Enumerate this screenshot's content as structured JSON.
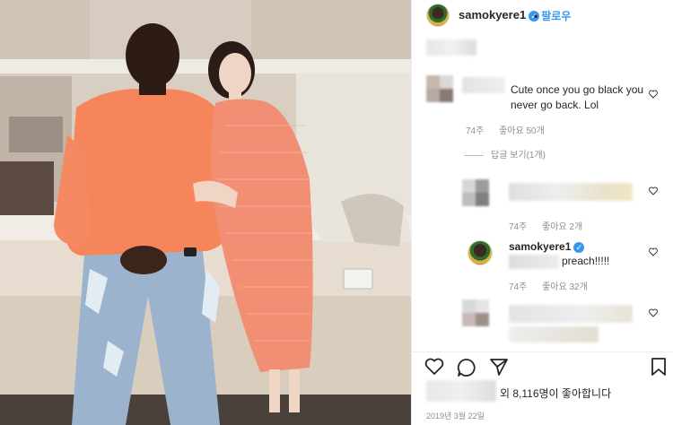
{
  "header": {
    "username": "samokyere1",
    "verified_mark": "✓",
    "follow_label": "팔로우"
  },
  "comments": [
    {
      "text": "Cute once you go black you never go back. Lol",
      "age": "74주",
      "likes": "좋아요 50개"
    },
    {
      "replies_label": "답글 보기(1개)"
    },
    {
      "age": "74주",
      "likes": "좋아요 2개"
    },
    {
      "username": "samokyere1",
      "text": "preach!!!!!",
      "age": "74주",
      "likes": "좋아요 32개"
    }
  ],
  "actions": {
    "icons": [
      "heart-icon",
      "comment-icon",
      "share-icon",
      "bookmark-icon"
    ]
  },
  "likes_line": "외 8,116명이 좋아합니다",
  "date": "2019년 3월 22일",
  "colors": {
    "link_blue": "#3897f0",
    "meta_gray": "#8e8e8e",
    "sweater_orange": "#f7855c"
  }
}
